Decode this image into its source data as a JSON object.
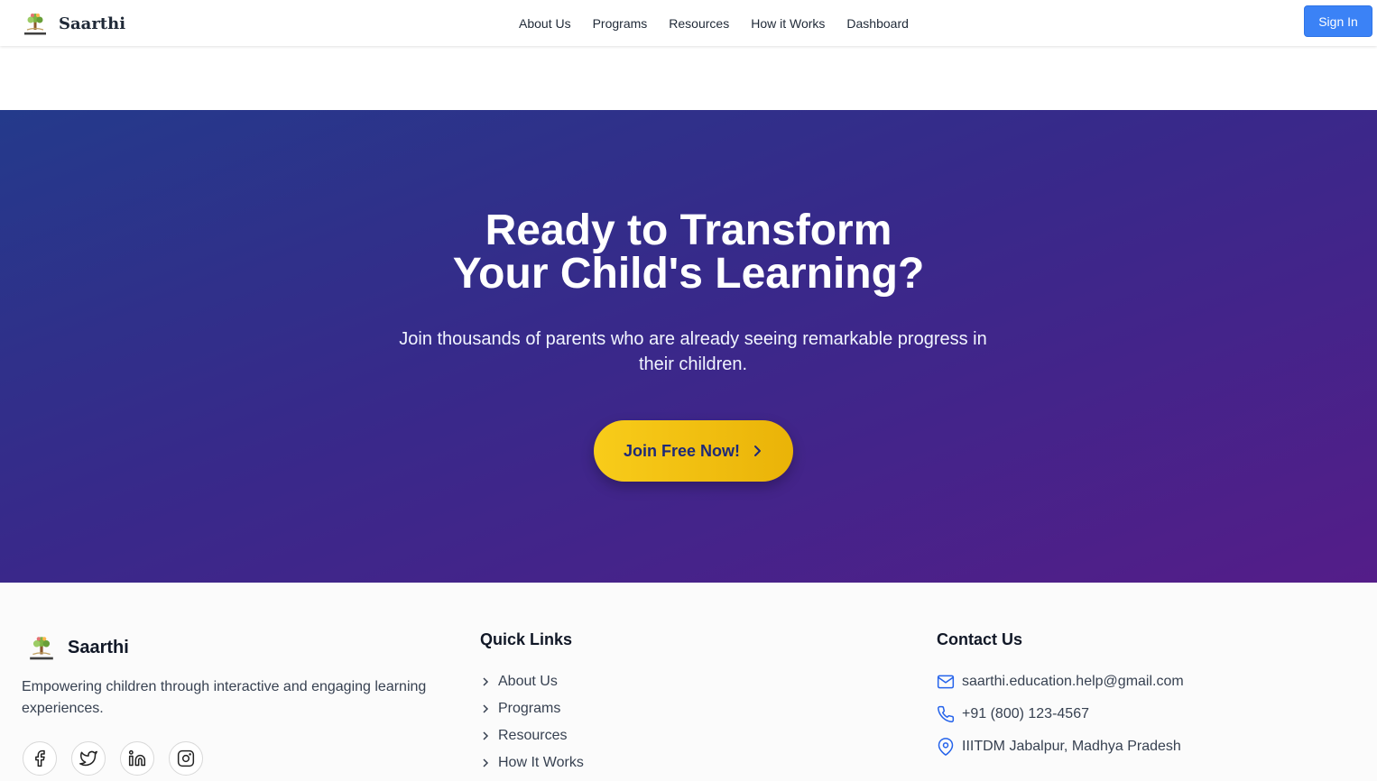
{
  "navbar": {
    "brand": "Saarthi",
    "logo_icon": "saarthi-tree-logo-icon",
    "links": [
      "About Us",
      "Programs",
      "Resources",
      "How it Works",
      "Dashboard"
    ],
    "signin_label": "Sign In",
    "signin_color": "#3b82f6"
  },
  "hero": {
    "title_line1": "Ready to Transform",
    "title_line2": "Your Child's Learning?",
    "subtitle": "Join thousands of parents who are already seeing remarkable progress in their children.",
    "cta_label": "Join Free Now!",
    "cta_icon": "chevron-right-icon",
    "gradient_colors": [
      "#243a8b",
      "#541d89"
    ],
    "cta_color": "#f5c518"
  },
  "footer": {
    "brand": "Saarthi",
    "tagline": "Empowering children through interactive and engaging learning experiences.",
    "socials": [
      "facebook-icon",
      "twitter-icon",
      "linkedin-icon",
      "instagram-icon"
    ],
    "quick_links_title": "Quick Links",
    "quick_links": [
      "About Us",
      "Programs",
      "Resources",
      "How It Works"
    ],
    "contact_title": "Contact Us",
    "contact": {
      "email": "saarthi.education.help@gmail.com",
      "phone": "+91 (800) 123-4567",
      "address": "IIITDM Jabalpur, Madhya Pradesh"
    },
    "contact_icon_color": "#2563eb"
  }
}
